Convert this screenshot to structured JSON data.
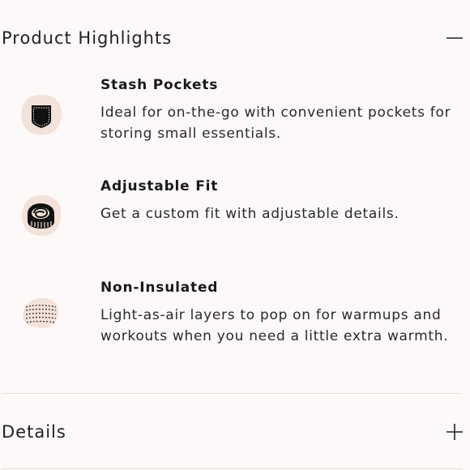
{
  "highlights": {
    "title": "Product Highlights",
    "toggle_icon": "minus-icon",
    "items": [
      {
        "title": "Stash Pockets",
        "description": "Ideal for on-the-go with convenient pockets for storing small essentials.",
        "icon": "pocket-icon"
      },
      {
        "title": "Adjustable Fit",
        "description": "Get a custom fit with adjustable details.",
        "icon": "measuring-tape-icon"
      },
      {
        "title": "Non-Insulated",
        "description": "Light-as-air layers to pop on for warmups and workouts when you need a little extra warmth.",
        "icon": "fabric-layer-icon"
      }
    ]
  },
  "details": {
    "title": "Details",
    "toggle_icon": "plus-icon"
  },
  "colors": {
    "background": "#fdf9f8",
    "icon_badge": "#f3e2d9",
    "text": "#1c1c1c",
    "divider": "#e5e1df"
  }
}
